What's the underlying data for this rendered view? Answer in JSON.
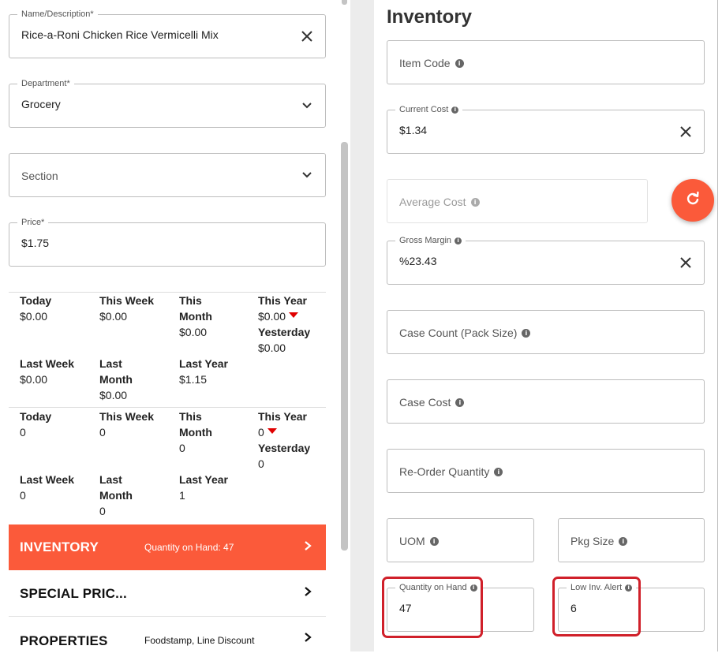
{
  "left": {
    "name_field": {
      "label": "Name/Description*",
      "value": "Rice-a-Roni Chicken Rice Vermicelli Mix"
    },
    "department_field": {
      "label": "Department*",
      "value": "Grocery"
    },
    "section_field": {
      "placeholder": "Section"
    },
    "price_field": {
      "label": "Price*",
      "value": "$1.75"
    },
    "sales_dollars": {
      "today": {
        "label": "Today",
        "value": "$0.00"
      },
      "this_week": {
        "label": "This Week",
        "value": "$0.00"
      },
      "this_month": {
        "label_1": "This",
        "label_2": "Month",
        "value": "$0.00"
      },
      "this_year": {
        "label": "This Year",
        "value": "$0.00"
      },
      "yesterday": {
        "label": "Yesterday",
        "value": "$0.00"
      },
      "last_week": {
        "label": "Last Week",
        "value": "$0.00"
      },
      "last_month": {
        "label_1": "Last",
        "label_2": "Month",
        "value": "$0.00"
      },
      "last_year": {
        "label": "Last Year",
        "value": "$1.15"
      }
    },
    "sales_units": {
      "today": {
        "label": "Today",
        "value": "0"
      },
      "this_week": {
        "label": "This Week",
        "value": "0"
      },
      "this_month": {
        "label_1": "This",
        "label_2": "Month",
        "value": "0"
      },
      "this_year": {
        "label": "This Year",
        "value": "0"
      },
      "yesterday": {
        "label": "Yesterday",
        "value": "0"
      },
      "last_week": {
        "label": "Last Week",
        "value": "0"
      },
      "last_month": {
        "label_1": "Last",
        "label_2": "Month",
        "value": "0"
      },
      "last_year": {
        "label": "Last Year",
        "value": "1"
      }
    },
    "accordions": {
      "inventory": {
        "title": "INVENTORY",
        "subtitle": "Quantity on Hand: 47"
      },
      "special_price": {
        "title": "SPECIAL PRIC..."
      },
      "properties": {
        "title": "PROPERTIES",
        "subtitle": "Foodstamp, Line Discount"
      }
    }
  },
  "right": {
    "heading": "Inventory",
    "item_code": {
      "placeholder": "Item Code"
    },
    "current_cost": {
      "label": "Current Cost",
      "value": "$1.34"
    },
    "average_cost": {
      "placeholder": "Average Cost"
    },
    "gross_margin": {
      "label": "Gross Margin",
      "value": "%23.43"
    },
    "case_count": {
      "placeholder": "Case Count (Pack Size)"
    },
    "case_cost": {
      "placeholder": "Case Cost"
    },
    "reorder_qty": {
      "placeholder": "Re-Order Quantity"
    },
    "uom": {
      "placeholder": "UOM"
    },
    "pkg_size": {
      "placeholder": "Pkg Size"
    },
    "qty_on_hand": {
      "label": "Quantity on Hand",
      "value": "47"
    },
    "low_inv_alert": {
      "label": "Low Inv. Alert",
      "value": "6"
    }
  },
  "colors": {
    "accent": "#fb5a3a",
    "highlight": "#d0202a",
    "down_arrow": "#e00000"
  },
  "icons": [
    "close-icon",
    "chevron-down-icon",
    "chevron-right-icon",
    "info-icon",
    "refresh-icon",
    "down-triangle-icon"
  ]
}
